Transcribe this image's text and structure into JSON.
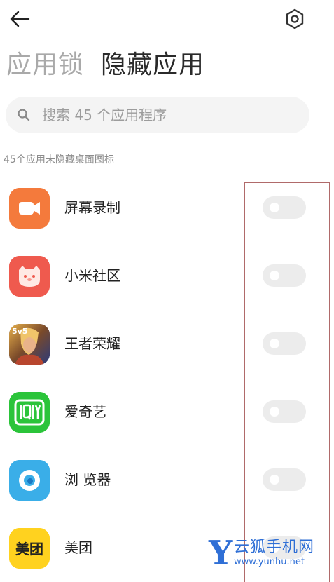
{
  "header": {
    "tabs": [
      {
        "label": "应用锁",
        "active": false
      },
      {
        "label": "隐藏应用",
        "active": true
      }
    ],
    "back_icon": "arrow-left-icon",
    "settings_icon": "gear-icon"
  },
  "search": {
    "placeholder": "搜索 45 个应用程序",
    "icon": "search-icon"
  },
  "subtitle": "45个应用未隐藏桌面图标",
  "apps": [
    {
      "name": "屏幕录制",
      "icon": "screen-recorder-icon",
      "hidden": false,
      "color": "#f47a3c"
    },
    {
      "name": "小米社区",
      "icon": "mi-community-icon",
      "hidden": false,
      "color": "#ef5a4e"
    },
    {
      "name": "王者荣耀",
      "icon": "honor-of-kings-icon",
      "hidden": false,
      "color": "#3b4a8c"
    },
    {
      "name": "爱奇艺",
      "icon": "iqiyi-icon",
      "hidden": false,
      "color": "#2bc43a"
    },
    {
      "name": "浏 览器",
      "icon": "browser-icon",
      "hidden": false,
      "color": "#3aaee8"
    },
    {
      "name": "美团",
      "icon": "meituan-icon",
      "hidden": false,
      "color": "#ffd21f",
      "icon_text": "美团"
    }
  ],
  "watermark": {
    "letter": "Y",
    "name": "云狐手机网",
    "url": "www.yunhu.net"
  }
}
